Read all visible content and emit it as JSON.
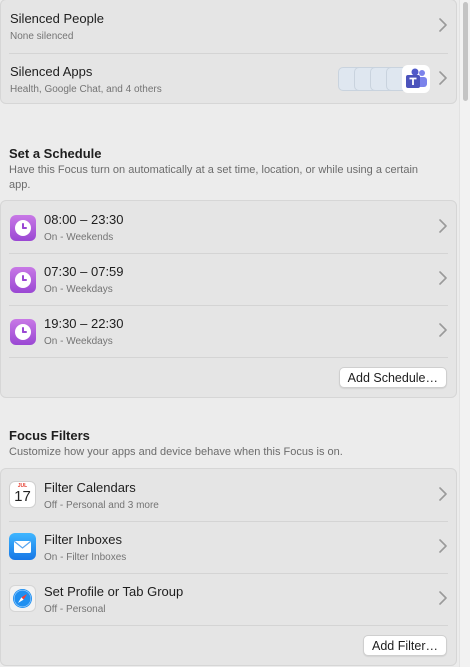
{
  "silenced": {
    "people": {
      "title": "Silenced People",
      "subtitle": "None silenced"
    },
    "apps": {
      "title": "Silenced Apps",
      "subtitle": "Health, Google Chat, and 4 others"
    }
  },
  "schedule": {
    "heading": "Set a Schedule",
    "description": "Have this Focus turn on automatically at a set time, location, or while using a certain app.",
    "items": [
      {
        "time": "08:00 – 23:30",
        "detail": "On - Weekends",
        "icon": "clock-icon"
      },
      {
        "time": "07:30 – 07:59",
        "detail": "On - Weekdays",
        "icon": "clock-icon"
      },
      {
        "time": "19:30 – 22:30",
        "detail": "On - Weekdays",
        "icon": "clock-icon"
      }
    ],
    "add_button": "Add Schedule…"
  },
  "filters": {
    "heading": "Focus Filters",
    "description": "Customize how your apps and device behave when this Focus is on.",
    "items": [
      {
        "title": "Filter Calendars",
        "detail": "Off - Personal and 3 more",
        "icon": "calendar-icon"
      },
      {
        "title": "Filter Inboxes",
        "detail": "On - Filter Inboxes",
        "icon": "mail-icon"
      },
      {
        "title": "Set Profile or Tab Group",
        "detail": "Off - Personal",
        "icon": "safari-icon"
      }
    ],
    "add_button": "Add Filter…"
  },
  "calendar_icon": {
    "month": "JUL",
    "day": "17"
  },
  "colors": {
    "focus_purple": "#a052d9",
    "mail_blue": "#1d8cf0",
    "background": "#ececec"
  }
}
